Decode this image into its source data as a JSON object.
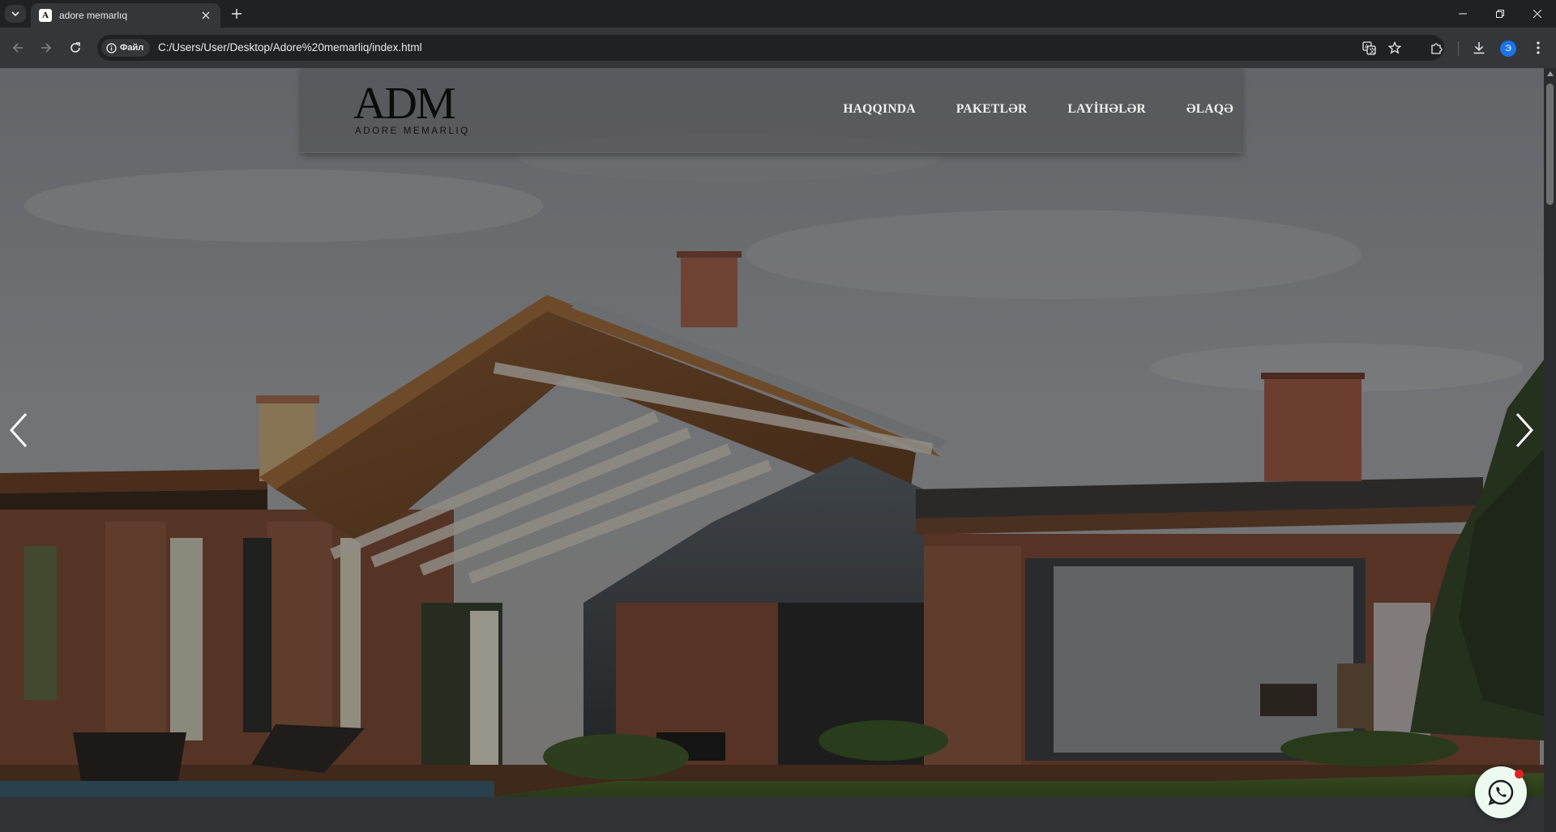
{
  "browser": {
    "tab_title": "adore memarlıq",
    "favicon_letter": "A",
    "site_chip": "Файл",
    "url": "C:/Users/User/Desktop/Adore%20memarliq/index.html",
    "profile_initial": "Э"
  },
  "site": {
    "logo_mark": "ADM",
    "logo_subtitle": "ADORE MEMARLIQ",
    "nav": [
      "HAQQINDA",
      "PAKETLƏR",
      "LAYİHƏLƏR",
      "ƏLAQƏ"
    ]
  },
  "hero": {
    "slider_prev": "prev-arrow",
    "slider_next": "next-arrow"
  },
  "colors": {
    "chrome_dark": "#202124",
    "chrome_toolbar": "#35363a",
    "accent": "#1a73e8",
    "whatsapp": "#25d366",
    "notification": "#e02424"
  }
}
